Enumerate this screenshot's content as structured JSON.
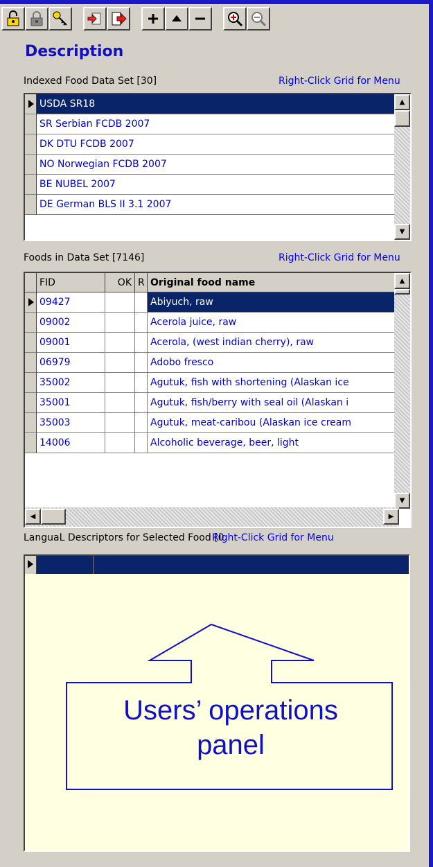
{
  "toolbar": {
    "buttons": [
      {
        "name": "lock-open-icon"
      },
      {
        "name": "lock-closed-icon"
      },
      {
        "name": "key-icon"
      },
      {
        "name": "copy-record-icon"
      },
      {
        "name": "export-record-icon"
      },
      {
        "name": "add-icon"
      },
      {
        "name": "move-up-icon"
      },
      {
        "name": "remove-icon"
      },
      {
        "name": "zoom-in-icon"
      },
      {
        "name": "zoom-out-icon"
      }
    ]
  },
  "section_title": "Description",
  "datasets": {
    "label": "Indexed Food Data Set [30]",
    "menu_hint": "Right-Click Grid for Menu",
    "rows": [
      "USDA SR18",
      "SR Serbian FCDB 2007",
      "DK DTU FCDB 2007",
      "NO Norwegian FCDB 2007",
      "BE NUBEL 2007",
      "DE German BLS II 3.1 2007"
    ],
    "selected_index": 0
  },
  "foods": {
    "label": "Foods in Data Set [7146]",
    "menu_hint": "Right-Click Grid for Menu",
    "columns": {
      "fid": "FID",
      "ok": "OK",
      "r": "R",
      "name": "Original food name"
    },
    "rows": [
      {
        "fid": "09427",
        "name": "Abiyuch, raw"
      },
      {
        "fid": "09002",
        "name": "Acerola juice, raw"
      },
      {
        "fid": "09001",
        "name": "Acerola, (west indian cherry), raw"
      },
      {
        "fid": "06979",
        "name": "Adobo fresco"
      },
      {
        "fid": "35002",
        "name": "Agutuk, fish with shortening (Alaskan ice"
      },
      {
        "fid": "35001",
        "name": "Agutuk, fish/berry with seal oil (Alaskan i"
      },
      {
        "fid": "35003",
        "name": "Agutuk, meat-caribou (Alaskan ice cream"
      },
      {
        "fid": "14006",
        "name": "Alcoholic beverage, beer, light"
      }
    ],
    "selected_index": 0
  },
  "langual": {
    "label": "LanguaL Descriptors for Selected Food [0",
    "menu_hint": "Right-Click Grid for Menu"
  },
  "callout": {
    "line1": "Users’ operations",
    "line2": "panel"
  },
  "colors": {
    "frame_blue": "#1b18c8",
    "selection": "#0a246a",
    "panel_bg": "#ffffe1",
    "link_blue": "#0000ff"
  }
}
